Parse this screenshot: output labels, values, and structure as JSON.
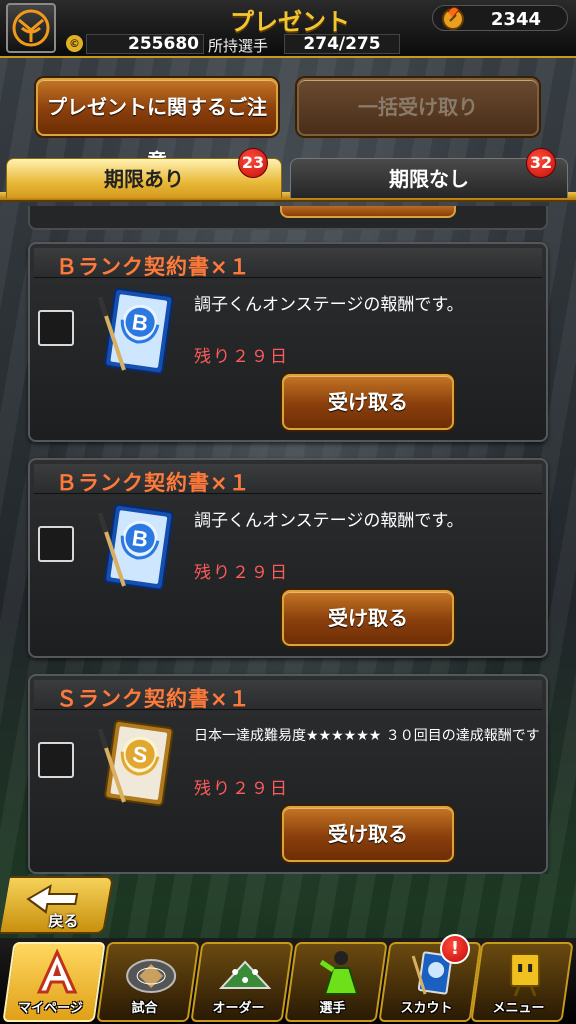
{
  "header": {
    "title": "プレゼント",
    "coins": "2344",
    "money_symbol": "©",
    "money": "255680",
    "players_label": "所持選手",
    "players": "274/275"
  },
  "actions": {
    "notice_label": "プレゼントに関するご注意",
    "bulk_receive_label": "一括受け取り"
  },
  "tabs": [
    {
      "label": "期限あり",
      "count": "23",
      "active": true
    },
    {
      "label": "期限なし",
      "count": "32",
      "active": false
    }
  ],
  "gifts": [
    {
      "title": "Ｂランク契約書×１",
      "description": "調子くんオンステージの報酬です。",
      "remaining": "残り２９日",
      "button": "受け取る",
      "rank": "B"
    },
    {
      "title": "Ｂランク契約書×１",
      "description": "調子くんオンステージの報酬です。",
      "remaining": "残り２９日",
      "button": "受け取る",
      "rank": "B"
    },
    {
      "title": "Ｓランク契約書×１",
      "description": "日本一達成難易度★★★★★★ ３０回目の達成報酬です",
      "remaining": "残り２９日",
      "button": "受け取る",
      "rank": "S"
    }
  ],
  "back_label": "戻る",
  "nav": [
    {
      "label": "マイページ",
      "icon": "mypage-icon",
      "active": true
    },
    {
      "label": "試合",
      "icon": "stadium-icon",
      "active": false
    },
    {
      "label": "オーダー",
      "icon": "field-order-icon",
      "active": false
    },
    {
      "label": "選手",
      "icon": "player-icon",
      "active": false
    },
    {
      "label": "スカウト",
      "icon": "scout-icon",
      "active": false
    },
    {
      "label": "メニュー",
      "icon": "menu-character-icon",
      "active": false
    }
  ],
  "scout_alert": "!",
  "colors": {
    "accent_gold": "#e9b93a",
    "button_brown": "#8a3f0c",
    "remaining_red": "#ff5a5a",
    "title_orange": "#ff7a3a"
  }
}
